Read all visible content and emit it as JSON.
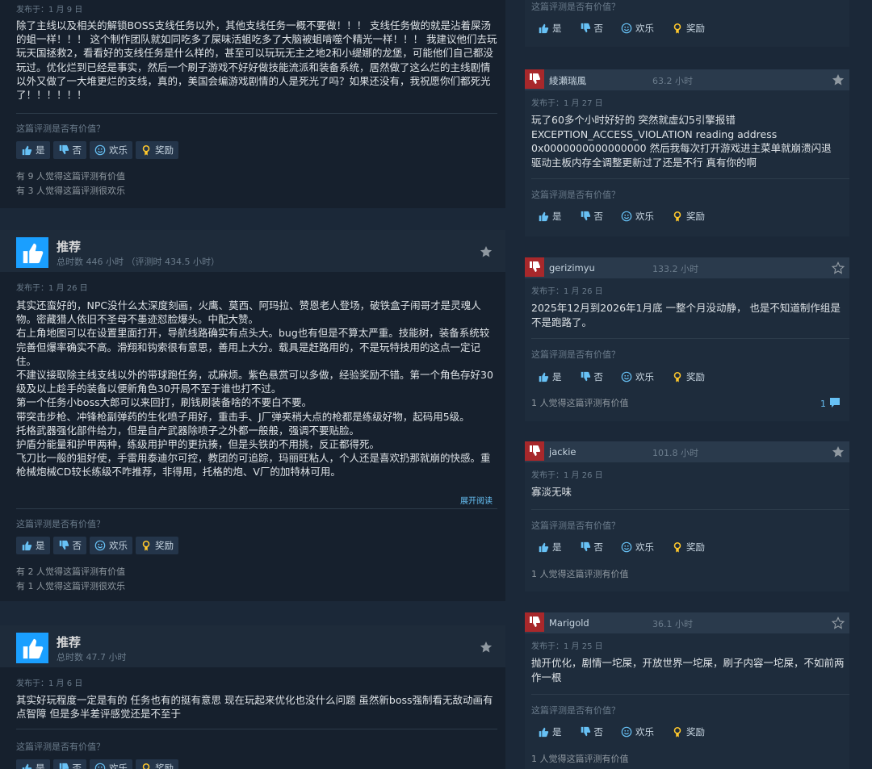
{
  "labels": {
    "posted_prefix": "发布于：",
    "question": "这篇评测是否有价值？",
    "yes": "是",
    "no": "否",
    "funny": "欢乐",
    "award": "奖励",
    "read_more": "展开阅读"
  },
  "left_reviews": [
    {
      "posted": "发布于：1 月 9 日",
      "body": "除了主线以及相关的解锁BOSS支线任务以外，其他支线任务一概不要做！！！ 支线任务做的就是沾着屎汤的蛆一样！！！ 这个制作团队就如同吃多了屎味活蛆吃多了大脑被蛆啃噬个精光一样！！！ 我建议他们去玩玩天国拯救2，看看好的支线任务是什么样的，甚至可以玩玩无主之地2和小缇娜的龙堡，可能他们自己都没玩过。优化烂到已经是事实，然后一个刷子游戏不好好做技能流派和装备系统，居然做了这么烂的主线剧情以外又做了一大堆更烂的支线，真的，美国会编游戏剧情的人是死光了吗？如果还没有，我祝愿你们都死光了！！！！！！",
      "helpful_1": "有 9 人觉得这篇评测有价值",
      "helpful_2": "有 3 人觉得这篇评测很欢乐"
    },
    {
      "title": "推荐",
      "hours": "总时数 446 小时 （评测时 434.5 小时）",
      "posted": "发布于：1 月 26 日",
      "body_lines": [
        "其实还蛮好的，NPC没什么太深度刻画，火鹰、莫西、阿玛拉、赞恩老人登场，破铁盒子闹哥才是灵魂人物。密藏猎人依旧不圣母不墨迹怼脸爆头。中配大赞。",
        "右上角地图可以在设置里面打开，导航线路确实有点头大。bug也有但是不算太严重。技能树，装备系统较完善但爆率确实不高。滑翔和钩索很有意思，善用上大分。载具是赶路用的，不是玩特技用的这点一定记住。",
        "不建议接取除主线支线以外的带球跑任务，忒麻烦。紫色悬赏可以多做，经验奖励不错。第一个角色存好30级及以上趁手的装备以便新角色30开局不至于谁也打不过。",
        "第一个任务小boss大郎可以来回打，刷钱刷装备啥的不要白不要。",
        "带突击步枪、冲锋枪副弹药的生化喷子用好，重击手、J厂弹夹稍大点的枪都是练级好物，起码用5级。",
        "托格武器强化部件给力，但是自产武器除喷子之外都一般般，强调不要贴脸。",
        "护盾分能量和护甲两种，练级用护甲的更抗揍，但是头铁的不用挑，反正都得死。",
        "飞刀比一般的狙好使，手雷用泰迪尔可控，教团的可追踪，玛丽旺粘人，个人还是喜欢扔那就崩的快感。重枪械炮械CD较长练级不咋推荐，非得用，托格的炮、V厂的加特林可用。"
      ],
      "helpful_1": "有 2 人觉得这篇评测有价值",
      "helpful_2": "有 1 人觉得这篇评测很欢乐"
    },
    {
      "title": "推荐",
      "hours": "总时数 47.7 小时",
      "posted": "发布于：1 月 6 日",
      "body": "其实好玩程度一定是有的 任务也有的挺有意思 现在玩起来优化也没什么问题 虽然新boss强制看无敌动画有点智障 但是多半差评感觉还是不至于"
    }
  ],
  "right_reviews": [
    {
      "name": "綾瀬瑞風",
      "hours": "63.2 小时",
      "posted": "发布于：1 月 27 日",
      "body": "玩了60多个小时好好的 突然就虚幻5引擎报错 EXCEPTION_ACCESS_VIOLATION reading address 0x0000000000000000 然后我每次打开游戏进主菜单就崩溃闪退 驱动主板内存全调整更新过了还是不行 真有你的啊",
      "helpful": ""
    },
    {
      "name": "gerizimyu",
      "hours": "133.2 小时",
      "posted": "发布于：1 月 26 日",
      "body": "2025年12月到2026年1月底 一整个月没动静， 也是不知道制作组是不是跑路了。",
      "helpful": "1 人觉得这篇评测有价值",
      "comments": "1"
    },
    {
      "name": "jackie",
      "hours": "101.8 小时",
      "posted": "发布于：1 月 26 日",
      "body": "寡淡无味",
      "helpful": "1 人觉得这篇评测有价值"
    },
    {
      "name": "Marigold",
      "hours": "36.1 小时",
      "posted": "发布于：1 月 25 日",
      "body": "抛开优化，剧情一坨屎，开放世界一坨屎，刷子内容一坨屎，不如前两作一根",
      "helpful": "1 人觉得这篇评测有价值"
    }
  ],
  "colors": {
    "background": "#1b2838",
    "card": "#16202d",
    "accent": "#67c1f5",
    "thumb_up": "#1a9fff",
    "thumb_down": "#a8282b"
  }
}
